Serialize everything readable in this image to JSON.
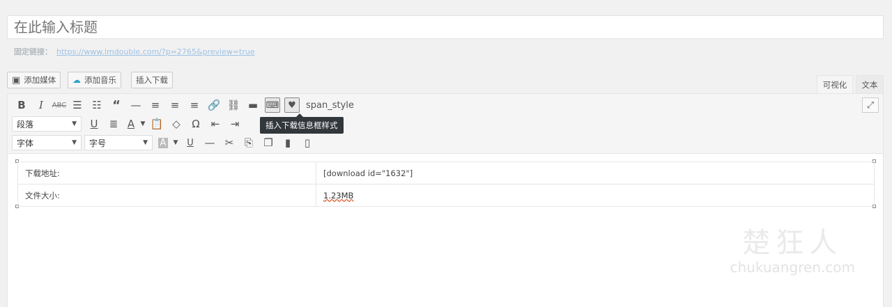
{
  "title": {
    "placeholder": "在此输入标题"
  },
  "permalink": {
    "label": "固定链接：",
    "url": "https://www.lmdouble.com/?p=2765&preview=true"
  },
  "media_buttons": [
    {
      "label": "添加媒体",
      "icon": "media-icon"
    },
    {
      "label": "添加音乐",
      "icon": "cloud-music-icon"
    },
    {
      "label": "插入下载",
      "icon": ""
    }
  ],
  "tabs": {
    "visual": "可视化",
    "text": "文本"
  },
  "toolbar": {
    "row1_text_button": "span_style",
    "format_select": "段落",
    "font_family_select": "字体",
    "font_size_select": "字号",
    "tooltip": "插入下载信息框样式"
  },
  "table": {
    "rows": [
      {
        "label": "下载地址:",
        "value": "[download id=\"1632\"]"
      },
      {
        "label": "文件大小:",
        "value": "1.23MB"
      }
    ]
  },
  "watermark": {
    "cn": "楚狂人",
    "en": "chukuangren.com"
  },
  "colors": {
    "link": "#9ec2e6",
    "tooltip_bg": "#32373c",
    "accent": "#2ea2cc"
  }
}
